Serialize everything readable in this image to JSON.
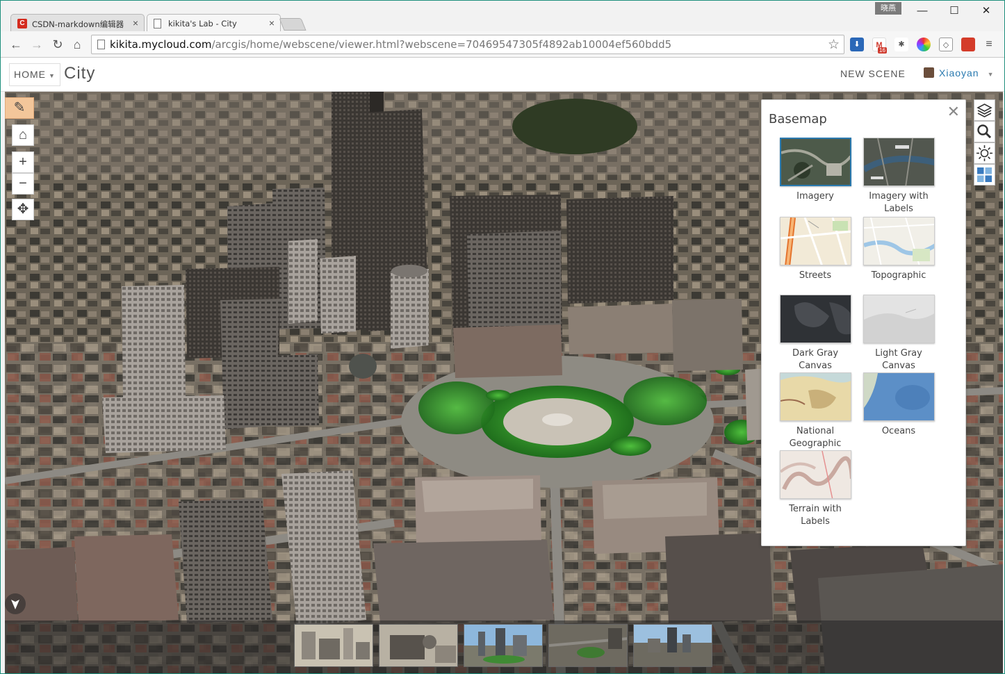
{
  "browser": {
    "tabs": [
      {
        "title": "CSDN-markdown编辑器",
        "favicon": "csdn-icon"
      },
      {
        "title": "kikita's Lab - City",
        "favicon": "page-icon"
      }
    ],
    "profile_badge": "晓燕",
    "url_host": "kikita.mycloud.com",
    "url_path": "/arcgis/home/webscene/viewer.html?webscene=70469547305f4892ab10004ef560bdd5",
    "gmail_count": "16"
  },
  "app": {
    "home_label": "HOME",
    "scene_title": "City",
    "new_scene_label": "NEW SCENE",
    "user_name": "Xiaoyan"
  },
  "basemap": {
    "title": "Basemap",
    "selected": "Imagery",
    "items": [
      {
        "label": "Imagery",
        "style": "imagery"
      },
      {
        "label": "Imagery with Labels",
        "style": "imagery-labels"
      },
      {
        "label": "Streets",
        "style": "streets"
      },
      {
        "label": "Topographic",
        "style": "topographic"
      },
      {
        "label": "Dark Gray Canvas",
        "style": "dark-gray"
      },
      {
        "label": "Light Gray Canvas",
        "style": "light-gray"
      },
      {
        "label": "National Geographic",
        "style": "natgeo"
      },
      {
        "label": "Oceans",
        "style": "oceans"
      },
      {
        "label": "Terrain with Labels",
        "style": "terrain"
      }
    ]
  },
  "slides": [
    "slide-1",
    "slide-2",
    "slide-3",
    "slide-4",
    "slide-5"
  ],
  "colors": {
    "accent": "#2a7ab0",
    "sketch_button": "#f3c69a"
  }
}
